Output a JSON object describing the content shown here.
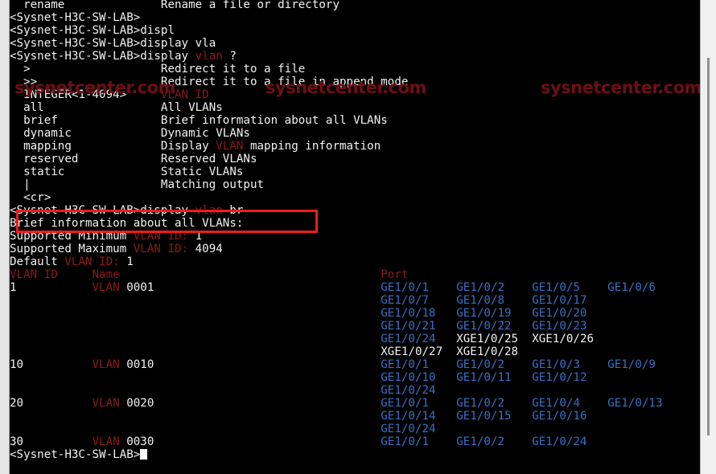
{
  "terminal": {
    "prompt": "<Sysnet-H3C-SW-LAB>",
    "cursor_visible": true,
    "colors": {
      "background": "#000000",
      "foreground": "#f2f2f2",
      "keyword": "#8b1a1a",
      "port_ge": "#3b6fc4",
      "annotation": "#ef1c1c"
    }
  },
  "scrollback": {
    "partial_top_line": {
      "command": "rename",
      "description": "Rename a file or directory"
    },
    "typed_commands": [
      "",
      "displ",
      "display vla"
    ],
    "help_query": {
      "command_prefix": "display",
      "keyword": "vlan",
      "query_char": "?"
    },
    "help_options": [
      {
        "token": ">",
        "description": "Redirect it to a file"
      },
      {
        "token": ">>",
        "description": "Redirect it to a file in append mode"
      },
      {
        "token": "INTEGER<1-4094>",
        "description": "VLAN ID",
        "description_keyword": true
      },
      {
        "token": "all",
        "description": "All VLANs"
      },
      {
        "token": "brief",
        "description": "Brief information about all VLANs"
      },
      {
        "token": "dynamic",
        "description": "Dynamic VLANs"
      },
      {
        "token": "mapping",
        "description": "Display VLAN mapping information"
      },
      {
        "token": "reserved",
        "description": "Reserved VLANs"
      },
      {
        "token": "static",
        "description": "Static VLANs"
      },
      {
        "token": "|",
        "description": "Matching output"
      },
      {
        "token": "<cr>",
        "description": ""
      }
    ]
  },
  "executed_command": {
    "prompt": "<Sysnet-H3C-SW-LAB>",
    "text": "display",
    "keyword": "vlan",
    "argument": "br",
    "highlighted": true
  },
  "output": {
    "heading": "Brief information about all VLANs:",
    "supported_minimum_label": "Supported Minimum",
    "supported_minimum_keyword": "VLAN ID:",
    "supported_minimum_value": "1",
    "supported_maximum_label": "Supported Maximum",
    "supported_maximum_keyword": "VLAN ID:",
    "supported_maximum_value": "4094",
    "default_label": "Default",
    "default_keyword": "VLAN ID:",
    "default_value": "1",
    "columns": {
      "vlan_id": "VLAN ID",
      "name": "Name",
      "port": "Port"
    },
    "rows": [
      {
        "vlan_id": "1",
        "name_keyword": "VLAN",
        "name_value": "0001",
        "port_lines": [
          [
            {
              "t": "GE1/0/1",
              "k": "ge"
            },
            {
              "t": "GE1/0/2",
              "k": "ge"
            },
            {
              "t": "GE1/0/5",
              "k": "ge"
            },
            {
              "t": "GE1/0/6",
              "k": "ge"
            }
          ],
          [
            {
              "t": "GE1/0/7",
              "k": "ge"
            },
            {
              "t": "GE1/0/8",
              "k": "ge"
            },
            {
              "t": "GE1/0/17",
              "k": "ge"
            }
          ],
          [
            {
              "t": "GE1/0/18",
              "k": "ge"
            },
            {
              "t": "GE1/0/19",
              "k": "ge"
            },
            {
              "t": "GE1/0/20",
              "k": "ge"
            }
          ],
          [
            {
              "t": "GE1/0/21",
              "k": "ge"
            },
            {
              "t": "GE1/0/22",
              "k": "ge"
            },
            {
              "t": "GE1/0/23",
              "k": "ge"
            }
          ],
          [
            {
              "t": "GE1/0/24",
              "k": "ge"
            },
            {
              "t": "XGE1/0/25",
              "k": "xge"
            },
            {
              "t": "XGE1/0/26",
              "k": "xge"
            }
          ],
          [
            {
              "t": "XGE1/0/27",
              "k": "xge"
            },
            {
              "t": "XGE1/0/28",
              "k": "xge"
            }
          ]
        ]
      },
      {
        "vlan_id": "10",
        "name_keyword": "VLAN",
        "name_value": "0010",
        "port_lines": [
          [
            {
              "t": "GE1/0/1",
              "k": "ge"
            },
            {
              "t": "GE1/0/2",
              "k": "ge"
            },
            {
              "t": "GE1/0/3",
              "k": "ge"
            },
            {
              "t": "GE1/0/9",
              "k": "ge"
            }
          ],
          [
            {
              "t": "GE1/0/10",
              "k": "ge"
            },
            {
              "t": "GE1/0/11",
              "k": "ge"
            },
            {
              "t": "GE1/0/12",
              "k": "ge"
            }
          ],
          [
            {
              "t": "GE1/0/24",
              "k": "ge"
            }
          ]
        ]
      },
      {
        "vlan_id": "20",
        "name_keyword": "VLAN",
        "name_value": "0020",
        "port_lines": [
          [
            {
              "t": "GE1/0/1",
              "k": "ge"
            },
            {
              "t": "GE1/0/2",
              "k": "ge"
            },
            {
              "t": "GE1/0/4",
              "k": "ge"
            },
            {
              "t": "GE1/0/13",
              "k": "ge"
            }
          ],
          [
            {
              "t": "GE1/0/14",
              "k": "ge"
            },
            {
              "t": "GE1/0/15",
              "k": "ge"
            },
            {
              "t": "GE1/0/16",
              "k": "ge"
            }
          ],
          [
            {
              "t": "GE1/0/24",
              "k": "ge"
            }
          ]
        ]
      },
      {
        "vlan_id": "30",
        "name_keyword": "VLAN",
        "name_value": "0030",
        "port_lines": [
          [
            {
              "t": "GE1/0/1",
              "k": "ge"
            },
            {
              "t": "GE1/0/2",
              "k": "ge"
            },
            {
              "t": "GE1/0/24",
              "k": "ge"
            }
          ]
        ]
      }
    ]
  },
  "final_prompt": "<Sysnet-H3C-SW-LAB>",
  "watermarks": [
    {
      "text": "sysnetcenter.com"
    },
    {
      "text": "sysnetcenter.com"
    },
    {
      "text": "sysnetcenter.com"
    }
  ]
}
